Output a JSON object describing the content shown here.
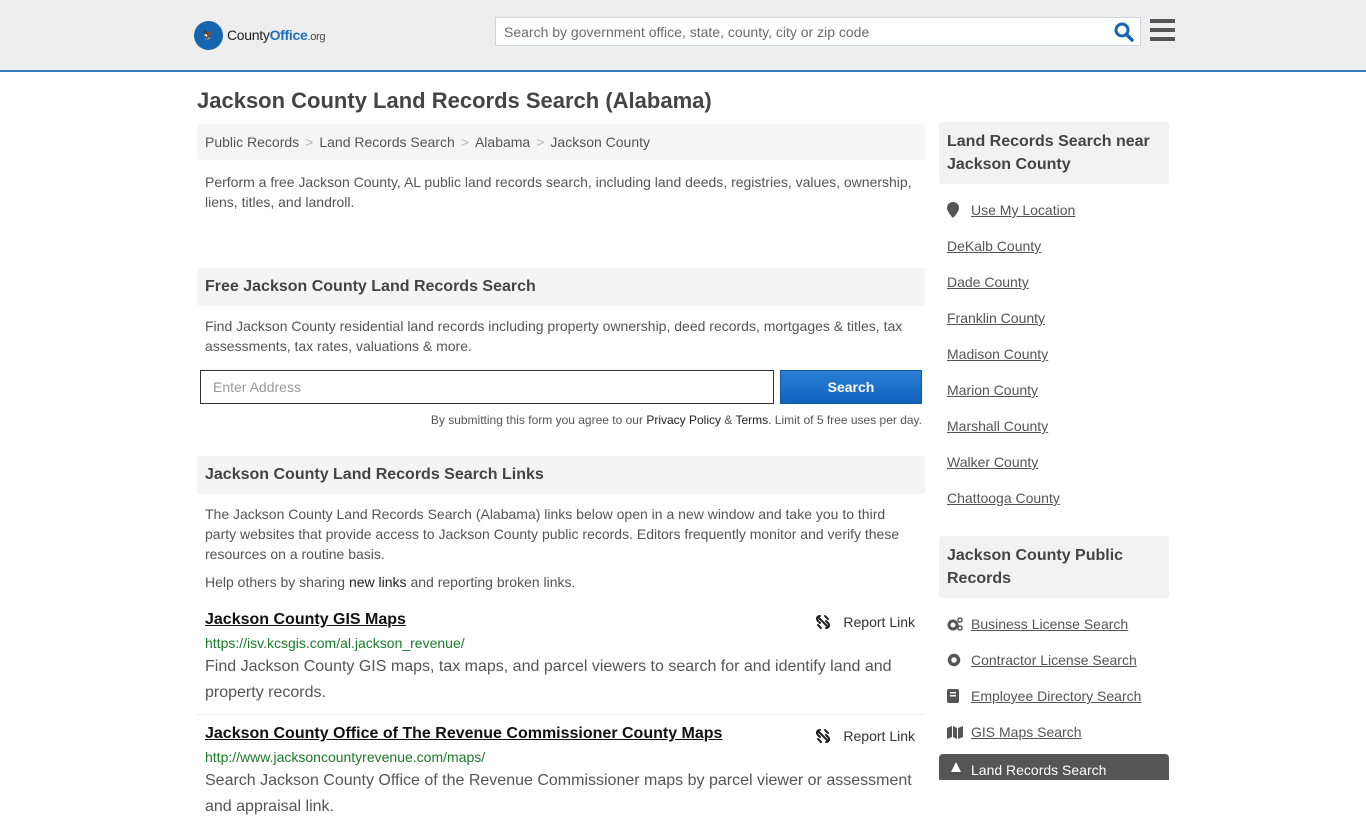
{
  "header": {
    "logo": {
      "brand_a": "County",
      "brand_b": "Office",
      "brand_c": ".org"
    },
    "search_placeholder": "Search by government office, state, county, city or zip code",
    "accent": "#337ab7"
  },
  "page_title": "Jackson County Land Records Search (Alabama)",
  "breadcrumb": [
    "Public Records",
    "Land Records Search",
    "Alabama",
    "Jackson County"
  ],
  "intro": "Perform a free Jackson County, AL public land records search, including land deeds, registries, values, ownership, liens, titles, and landroll.",
  "free_search": {
    "heading": "Free Jackson County Land Records Search",
    "text": "Find Jackson County residential land records including property ownership, deed records, mortgages & titles, tax assessments, tax rates, valuations & more.",
    "input_placeholder": "Enter Address",
    "button": "Search",
    "disclaimer_pre": "By submitting this form you agree to our ",
    "privacy": "Privacy Policy",
    "amp": " & ",
    "terms": "Terms",
    "disclaimer_post": ". Limit of 5 free uses per day."
  },
  "links_section": {
    "heading": "Jackson County Land Records Search Links",
    "text": "The Jackson County Land Records Search (Alabama) links below open in a new window and take you to third party websites that provide access to Jackson County public records. Editors frequently monitor and verify these resources on a routine basis.",
    "help_pre": "Help others by sharing ",
    "help_link": "new links",
    "help_post": " and reporting broken links.",
    "report_label": "Report Link",
    "results": [
      {
        "title": "Jackson County GIS Maps",
        "url": "https://isv.kcsgis.com/al.jackson_revenue/",
        "desc": "Find Jackson County GIS maps, tax maps, and parcel viewers to search for and identify land and property records."
      },
      {
        "title": "Jackson County Office of The Revenue Commissioner County Maps",
        "url": "http://www.jacksoncountyrevenue.com/maps/",
        "desc": "Search Jackson County Office of the Revenue Commissioner maps by parcel viewer or assessment and appraisal link."
      }
    ]
  },
  "sidebar": {
    "nearby_heading": "Land Records Search near Jackson County",
    "use_location": "Use My Location",
    "nearby": [
      "DeKalb County",
      "Dade County",
      "Franklin County",
      "Madison County",
      "Marion County",
      "Marshall County",
      "Walker County",
      "Chattooga County"
    ],
    "public_heading": "Jackson County Public Records",
    "public_records": [
      {
        "label": "Business License Search",
        "icon": "cogs-icon"
      },
      {
        "label": "Contractor License Search",
        "icon": "gear-icon"
      },
      {
        "label": "Employee Directory Search",
        "icon": "book-icon"
      },
      {
        "label": "GIS Maps Search",
        "icon": "map-icon"
      }
    ],
    "active_item": "Land Records Search"
  }
}
